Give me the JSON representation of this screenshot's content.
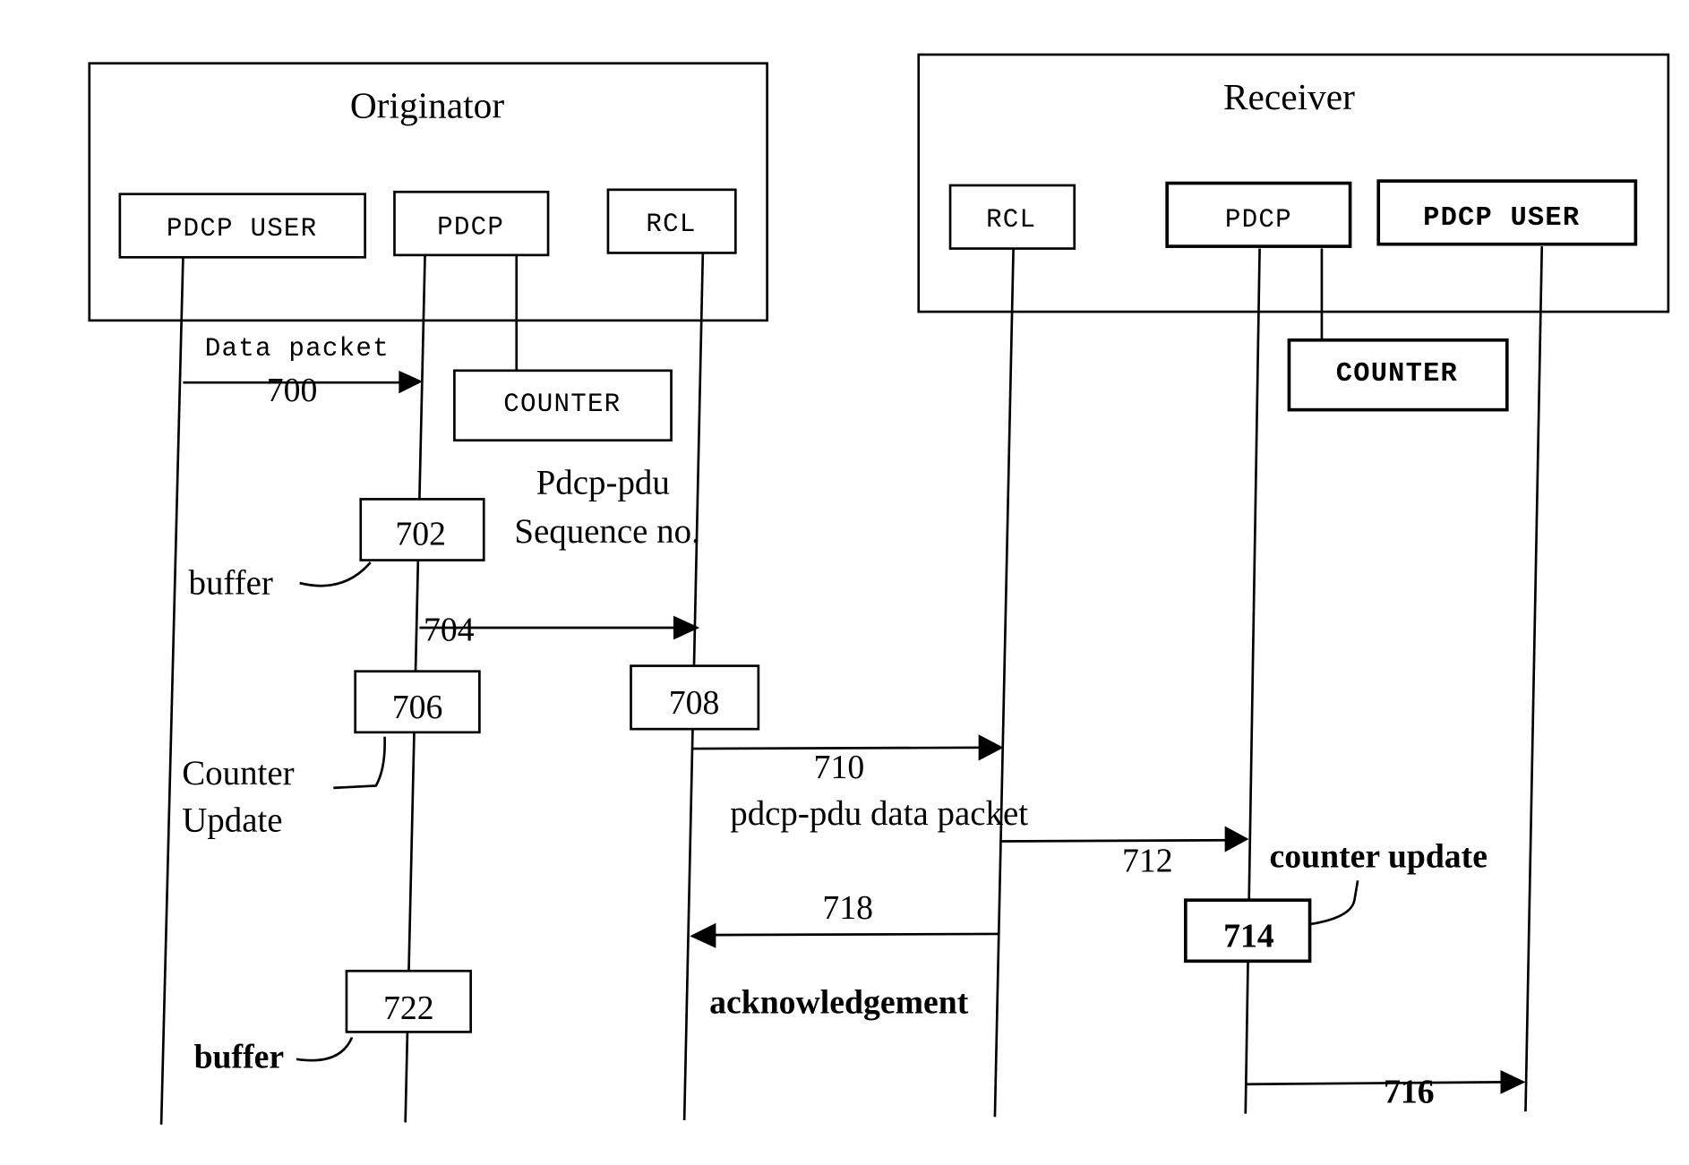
{
  "originator": {
    "title": "Originator",
    "entities": {
      "pdcp_user": "PDCP USER",
      "pdcp": "PDCP",
      "rcl": "RCL",
      "counter": "COUNTER"
    }
  },
  "receiver": {
    "title": "Receiver",
    "entities": {
      "rcl": "RCL",
      "pdcp": "PDCP",
      "pdcp_user": "PDCP USER",
      "counter": "COUNTER"
    }
  },
  "steps": {
    "s700": "700",
    "s702": "702",
    "s704": "704",
    "s706": "706",
    "s708": "708",
    "s710": "710",
    "s712": "712",
    "s714": "714",
    "s716": "716",
    "s718": "718",
    "s722": "722"
  },
  "labels": {
    "data_packet": "Data packet",
    "pdcp_pdu": "Pdcp-pdu",
    "sequence_no": "Sequence no.",
    "buffer_1": "buffer",
    "counter": "Counter",
    "update": "Update",
    "pdcp_pdu_data_packet": "pdcp-pdu data packet",
    "counter_update": "counter update",
    "acknowledgement": "acknowledgement",
    "buffer_2": "buffer"
  }
}
